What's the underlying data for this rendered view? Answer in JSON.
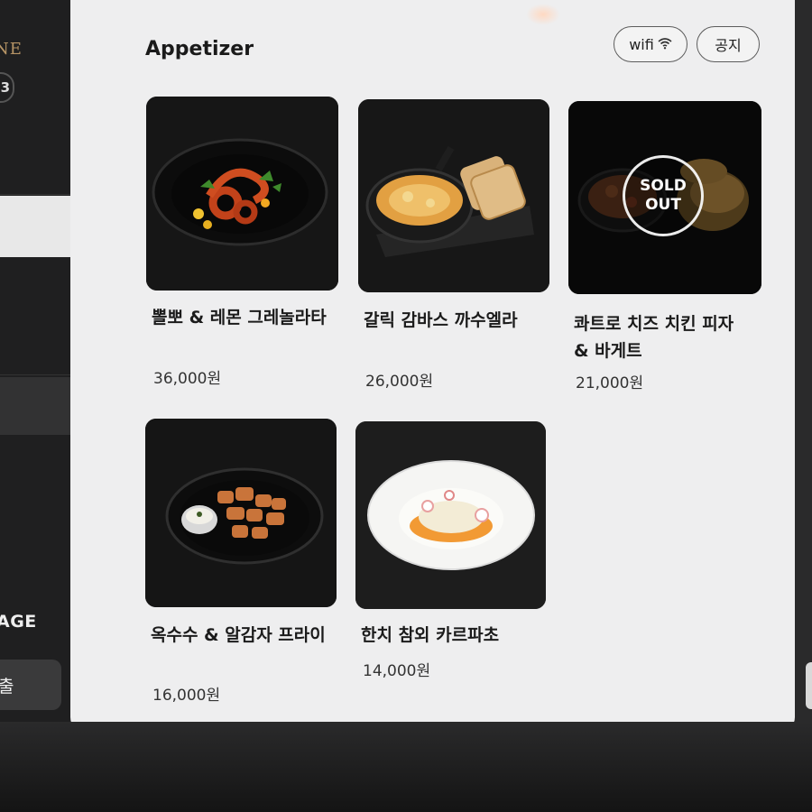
{
  "sidebar": {
    "brand_fragment": "NE",
    "table_number": "3",
    "language_fragment": "AGE",
    "exit_fragment": "출"
  },
  "header": {
    "category_title": "Appetizer",
    "wifi_label": "wifi",
    "notice_label": "공지"
  },
  "menu_items": [
    {
      "name": "뽈뽀 & 레몬 그레놀라타",
      "price": "36,000원",
      "sold_out": false
    },
    {
      "name": "갈릭 감바스 까수엘라",
      "price": "26,000원",
      "sold_out": false
    },
    {
      "name": "콰트로 치즈 치킨 피자 & 바게트",
      "price": "21,000원",
      "sold_out": true,
      "badge": "SOLD OUT"
    },
    {
      "name": "옥수수 & 알감자 프라이",
      "price": "16,000원",
      "sold_out": false
    },
    {
      "name": "한치 참외 카르파초",
      "price": "14,000원",
      "sold_out": false
    }
  ],
  "icons": {
    "wifi": "wifi-icon"
  },
  "colors": {
    "panel": "#eeeeef",
    "sidebar": "#1f1f20",
    "brand": "#b79566"
  }
}
